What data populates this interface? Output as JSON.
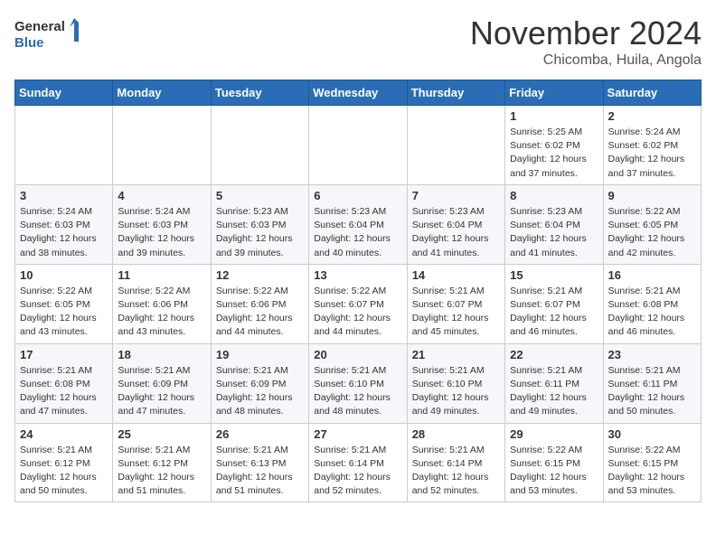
{
  "header": {
    "logo_line1": "General",
    "logo_line2": "Blue",
    "month_year": "November 2024",
    "location": "Chicomba, Huila, Angola"
  },
  "days_of_week": [
    "Sunday",
    "Monday",
    "Tuesday",
    "Wednesday",
    "Thursday",
    "Friday",
    "Saturday"
  ],
  "weeks": [
    [
      {
        "day": null
      },
      {
        "day": null
      },
      {
        "day": null
      },
      {
        "day": null
      },
      {
        "day": null
      },
      {
        "day": 1,
        "sunrise": "5:25 AM",
        "sunset": "6:02 PM",
        "daylight": "12 hours and 37 minutes."
      },
      {
        "day": 2,
        "sunrise": "5:24 AM",
        "sunset": "6:02 PM",
        "daylight": "12 hours and 37 minutes."
      }
    ],
    [
      {
        "day": 3,
        "sunrise": "5:24 AM",
        "sunset": "6:03 PM",
        "daylight": "12 hours and 38 minutes."
      },
      {
        "day": 4,
        "sunrise": "5:24 AM",
        "sunset": "6:03 PM",
        "daylight": "12 hours and 39 minutes."
      },
      {
        "day": 5,
        "sunrise": "5:23 AM",
        "sunset": "6:03 PM",
        "daylight": "12 hours and 39 minutes."
      },
      {
        "day": 6,
        "sunrise": "5:23 AM",
        "sunset": "6:04 PM",
        "daylight": "12 hours and 40 minutes."
      },
      {
        "day": 7,
        "sunrise": "5:23 AM",
        "sunset": "6:04 PM",
        "daylight": "12 hours and 41 minutes."
      },
      {
        "day": 8,
        "sunrise": "5:23 AM",
        "sunset": "6:04 PM",
        "daylight": "12 hours and 41 minutes."
      },
      {
        "day": 9,
        "sunrise": "5:22 AM",
        "sunset": "6:05 PM",
        "daylight": "12 hours and 42 minutes."
      }
    ],
    [
      {
        "day": 10,
        "sunrise": "5:22 AM",
        "sunset": "6:05 PM",
        "daylight": "12 hours and 43 minutes."
      },
      {
        "day": 11,
        "sunrise": "5:22 AM",
        "sunset": "6:06 PM",
        "daylight": "12 hours and 43 minutes."
      },
      {
        "day": 12,
        "sunrise": "5:22 AM",
        "sunset": "6:06 PM",
        "daylight": "12 hours and 44 minutes."
      },
      {
        "day": 13,
        "sunrise": "5:22 AM",
        "sunset": "6:07 PM",
        "daylight": "12 hours and 44 minutes."
      },
      {
        "day": 14,
        "sunrise": "5:21 AM",
        "sunset": "6:07 PM",
        "daylight": "12 hours and 45 minutes."
      },
      {
        "day": 15,
        "sunrise": "5:21 AM",
        "sunset": "6:07 PM",
        "daylight": "12 hours and 46 minutes."
      },
      {
        "day": 16,
        "sunrise": "5:21 AM",
        "sunset": "6:08 PM",
        "daylight": "12 hours and 46 minutes."
      }
    ],
    [
      {
        "day": 17,
        "sunrise": "5:21 AM",
        "sunset": "6:08 PM",
        "daylight": "12 hours and 47 minutes."
      },
      {
        "day": 18,
        "sunrise": "5:21 AM",
        "sunset": "6:09 PM",
        "daylight": "12 hours and 47 minutes."
      },
      {
        "day": 19,
        "sunrise": "5:21 AM",
        "sunset": "6:09 PM",
        "daylight": "12 hours and 48 minutes."
      },
      {
        "day": 20,
        "sunrise": "5:21 AM",
        "sunset": "6:10 PM",
        "daylight": "12 hours and 48 minutes."
      },
      {
        "day": 21,
        "sunrise": "5:21 AM",
        "sunset": "6:10 PM",
        "daylight": "12 hours and 49 minutes."
      },
      {
        "day": 22,
        "sunrise": "5:21 AM",
        "sunset": "6:11 PM",
        "daylight": "12 hours and 49 minutes."
      },
      {
        "day": 23,
        "sunrise": "5:21 AM",
        "sunset": "6:11 PM",
        "daylight": "12 hours and 50 minutes."
      }
    ],
    [
      {
        "day": 24,
        "sunrise": "5:21 AM",
        "sunset": "6:12 PM",
        "daylight": "12 hours and 50 minutes."
      },
      {
        "day": 25,
        "sunrise": "5:21 AM",
        "sunset": "6:12 PM",
        "daylight": "12 hours and 51 minutes."
      },
      {
        "day": 26,
        "sunrise": "5:21 AM",
        "sunset": "6:13 PM",
        "daylight": "12 hours and 51 minutes."
      },
      {
        "day": 27,
        "sunrise": "5:21 AM",
        "sunset": "6:14 PM",
        "daylight": "12 hours and 52 minutes."
      },
      {
        "day": 28,
        "sunrise": "5:21 AM",
        "sunset": "6:14 PM",
        "daylight": "12 hours and 52 minutes."
      },
      {
        "day": 29,
        "sunrise": "5:22 AM",
        "sunset": "6:15 PM",
        "daylight": "12 hours and 53 minutes."
      },
      {
        "day": 30,
        "sunrise": "5:22 AM",
        "sunset": "6:15 PM",
        "daylight": "12 hours and 53 minutes."
      }
    ]
  ]
}
